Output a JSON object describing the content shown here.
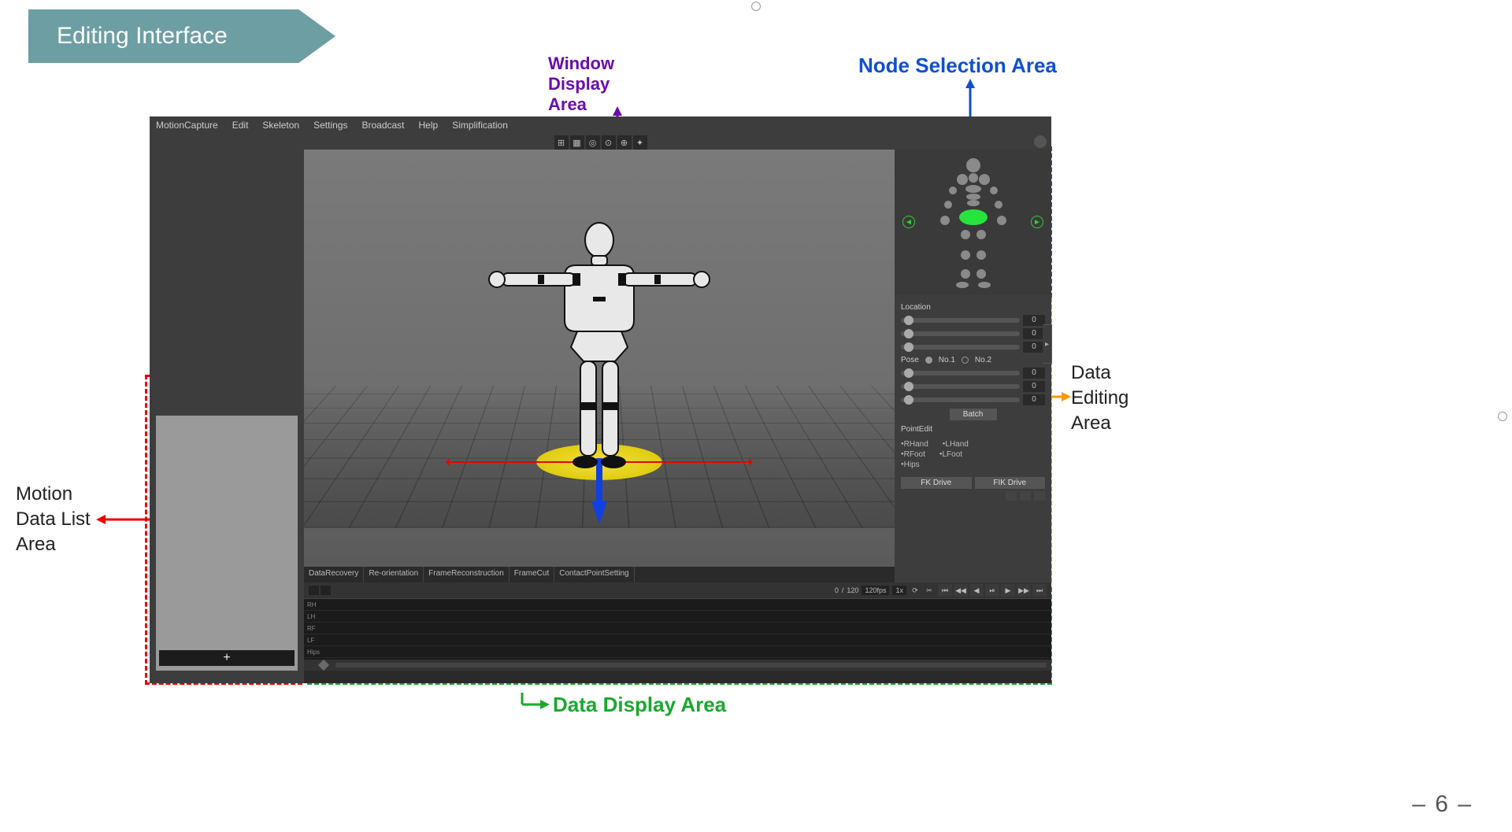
{
  "slide": {
    "title": "Editing Interface",
    "page_number": "– 6 –"
  },
  "callouts": {
    "window_display_area": "Window\nDisplay\nArea",
    "node_selection_area": "Node Selection Area",
    "data_editing_area_l1": "Data",
    "data_editing_area_l2": "Editing",
    "data_editing_area_l3": "Area",
    "motion_data_list_l1": "Motion",
    "motion_data_list_l2": "Data List",
    "motion_data_list_l3": "Area",
    "data_display_area": "Data Display Area"
  },
  "menu": [
    "MotionCapture",
    "Edit",
    "Skeleton",
    "Settings",
    "Broadcast",
    "Help",
    "Simplification"
  ],
  "viewport_icons": [
    "⊞",
    "▦",
    "◎",
    "⊙",
    "⊕",
    "✦"
  ],
  "tabs": [
    "DataRecovery",
    "Re-orientation",
    "FrameReconstruction",
    "FrameCut",
    "ContactPointSetting"
  ],
  "right": {
    "location_header": "Location",
    "location_values": [
      "0",
      "0",
      "0"
    ],
    "pose_header": "Pose",
    "pose_opts": [
      "No.1",
      "No.2"
    ],
    "pose_values": [
      "0",
      "0",
      "0"
    ],
    "batch": "Batch",
    "point_edit_header": "PointEdit",
    "points": [
      [
        "RHand",
        "LHand"
      ],
      [
        "RFoot",
        "LFoot"
      ],
      [
        "Hips",
        ""
      ]
    ],
    "drive": [
      "FK Drive",
      "FIK Drive"
    ]
  },
  "mdl_add": "+",
  "timeline": {
    "frame_start": "0",
    "frame_end": "120",
    "frame_cur": "0",
    "fps": "120fps",
    "speed": "1x",
    "tracks": [
      "RH",
      "LH",
      "RF",
      "LF",
      "Hips"
    ],
    "transport_icons": [
      "⏮",
      "◀◀",
      "◀",
      "⏯",
      "▶",
      "▶▶",
      "⏭"
    ]
  }
}
